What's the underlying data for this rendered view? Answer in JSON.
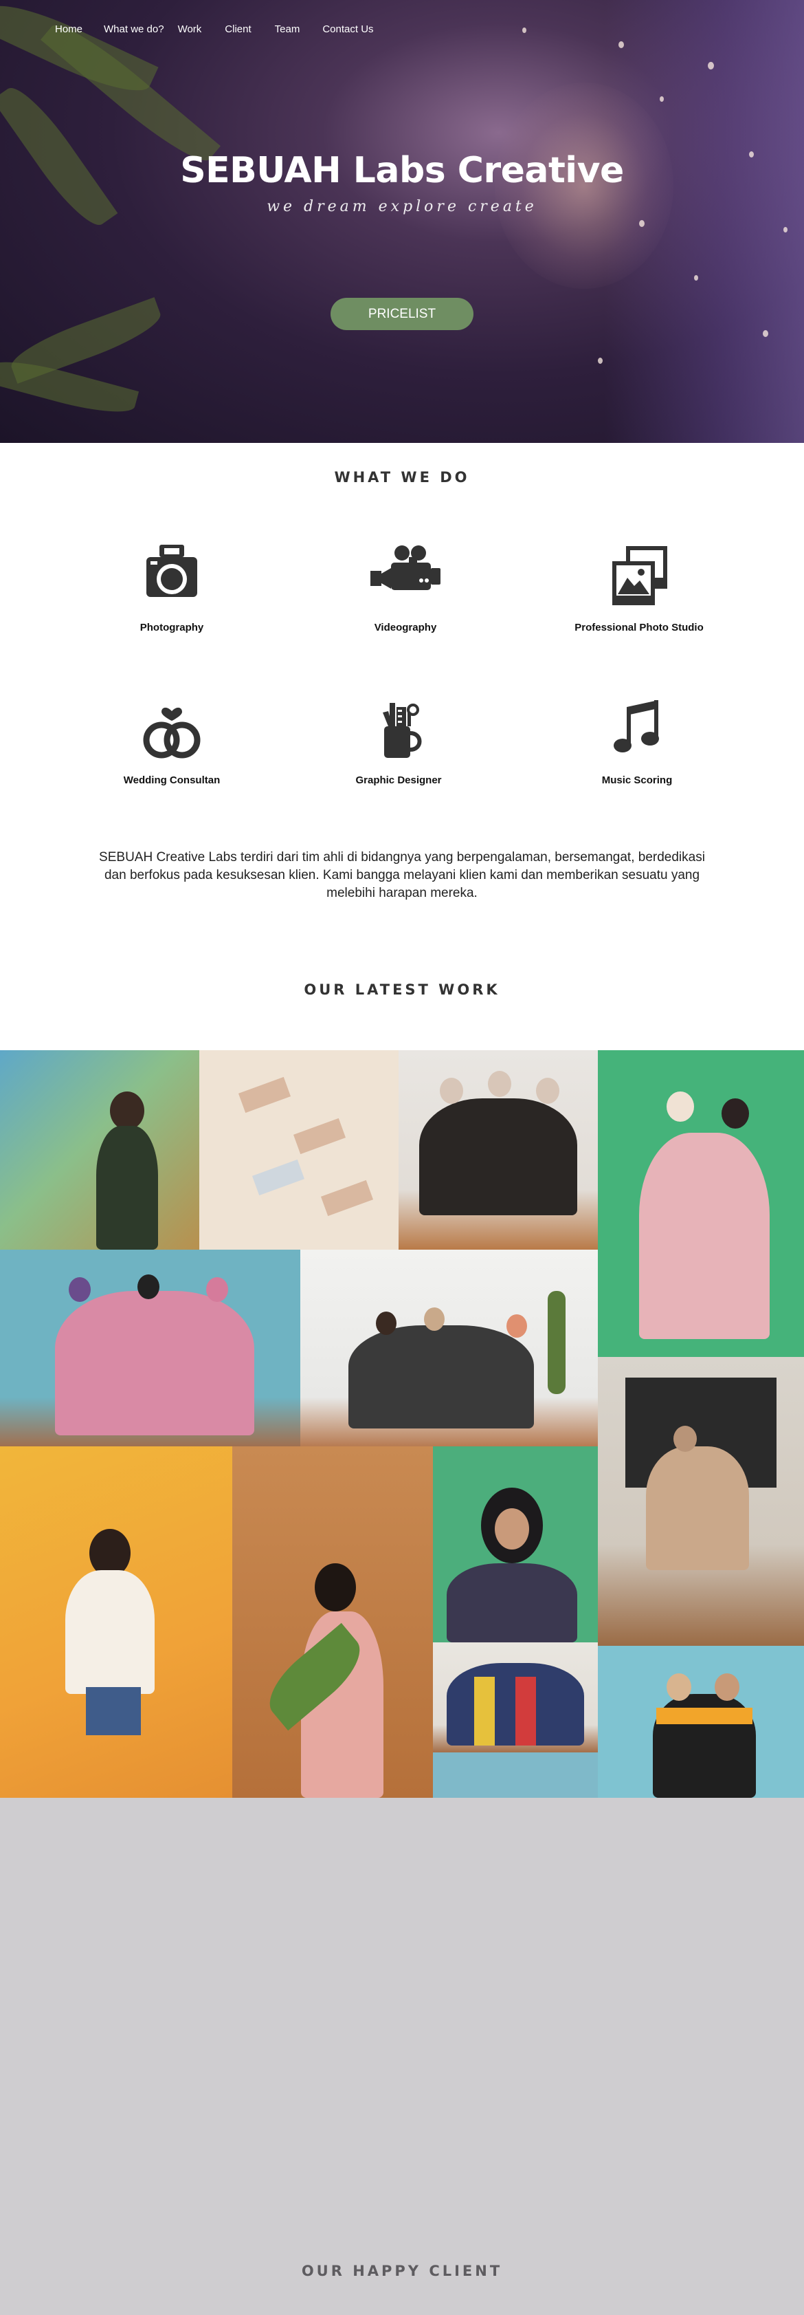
{
  "nav": {
    "items": [
      "Home",
      "What we do?",
      "Work",
      "Client",
      "Team",
      "Contact Us"
    ]
  },
  "hero": {
    "title": "SEBUAH Labs Creative",
    "tagline": "we dream explore create",
    "cta_label": "PRICELIST"
  },
  "what_we_do": {
    "heading": "WHAT WE DO",
    "services": [
      {
        "label": "Photography",
        "icon": "camera-icon"
      },
      {
        "label": "Videography",
        "icon": "video-camera-icon"
      },
      {
        "label": "Professional Photo Studio",
        "icon": "photo-studio-icon"
      },
      {
        "label": "Wedding Consultan",
        "icon": "wedding-rings-icon"
      },
      {
        "label": "Graphic Designer",
        "icon": "design-tools-icon"
      },
      {
        "label": "Music Scoring",
        "icon": "music-note-icon"
      }
    ],
    "about": "SEBUAH Creative Labs terdiri dari tim ahli di bidangnya yang berpengalaman, bersemangat, berdedikasi dan berfokus pada kesuksesan klien. Kami bangga melayani klien kami dan memberikan sesuatu yang melebihi harapan mereka."
  },
  "latest_work": {
    "heading": "OUR LATEST WORK"
  },
  "clients": {
    "heading": "OUR HAPPY CLIENT"
  },
  "colors": {
    "accent": "#6f8e62",
    "client_bg": "#cfcdd0"
  }
}
